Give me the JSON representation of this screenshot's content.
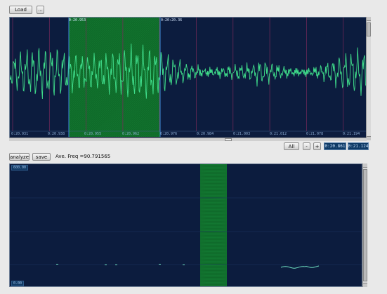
{
  "toolbar": {
    "load_label": "Load",
    "small_label": "..."
  },
  "waveform": {
    "selection_start_label": "0:20.953",
    "selection_end_label": "0:20:20.36",
    "time_ticks": [
      "0:20.931",
      "0:20.938",
      "0:20.955",
      "0:20.962",
      "0:20.976",
      "0:20.984",
      "0:21.003",
      "0:21.012",
      "0:21.078",
      "0:21.194"
    ],
    "colors": {
      "background": "#0c1c3e",
      "signal": "#3fdc8a",
      "selection": "#0f6a2a",
      "grid": "#7a2a5a"
    }
  },
  "nav": {
    "all_label": "All",
    "minus_label": "-",
    "plus_label": "+",
    "start_time": "0:20.861",
    "end_time": "0:21.124"
  },
  "analysis": {
    "analyze_label": "analyze",
    "save_label": "save",
    "status_text": "Ave. Freq =90.791565"
  },
  "spectrum": {
    "y_top_label": "600.00",
    "y_bottom_label": "0.00"
  },
  "icons": {
    "scroll_up": "scroll-up-arrow-icon",
    "scroll_down": "scroll-down-arrow-icon"
  }
}
